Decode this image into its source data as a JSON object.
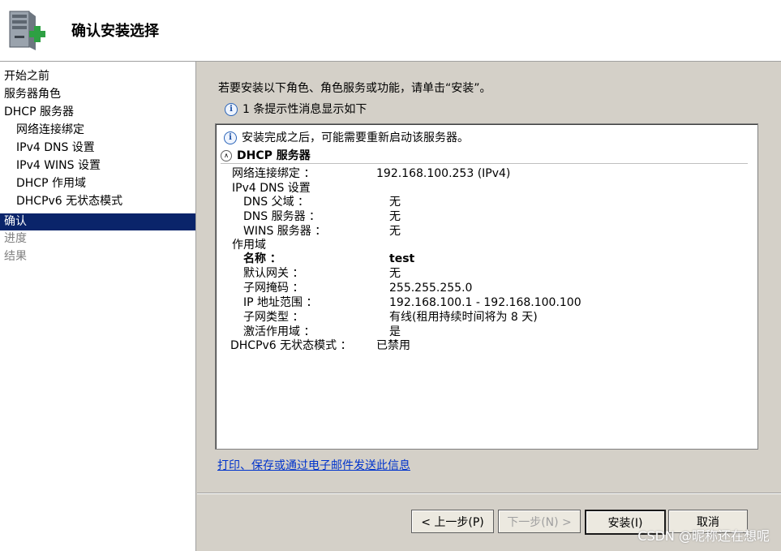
{
  "header": {
    "title": "确认安装选择",
    "icon": "server-add-icon"
  },
  "nav": [
    {
      "label": "开始之前",
      "state": "normal",
      "level": 0
    },
    {
      "label": "服务器角色",
      "state": "normal",
      "level": 0
    },
    {
      "label": "DHCP 服务器",
      "state": "normal",
      "level": 0
    },
    {
      "label": "网络连接绑定",
      "state": "normal",
      "level": 1
    },
    {
      "label": "IPv4 DNS 设置",
      "state": "normal",
      "level": 1
    },
    {
      "label": "IPv4 WINS 设置",
      "state": "normal",
      "level": 1
    },
    {
      "label": "DHCP 作用域",
      "state": "normal",
      "level": 1
    },
    {
      "label": "DHCPv6 无状态模式",
      "state": "normal",
      "level": 1
    },
    {
      "label": "确认",
      "state": "active",
      "level": 0
    },
    {
      "label": "进度",
      "state": "disabled",
      "level": 0
    },
    {
      "label": "结果",
      "state": "disabled",
      "level": 0
    }
  ],
  "main": {
    "intro": "若要安装以下角色、角色服务或功能，请单击“安装”。",
    "info_count": "1 条提示性消息显示如下",
    "panel": {
      "note": "安装完成之后，可能需要重新启动该服务器。",
      "section_title": "DHCP 服务器",
      "rows": [
        {
          "label": "网络连接绑定 ：",
          "value": "192.168.100.253 (IPv4)"
        },
        {
          "label": "IPv4 DNS 设置",
          "value": ""
        },
        {
          "label": "DNS 父域 ：",
          "value": "无"
        },
        {
          "label": "DNS 服务器 ：",
          "value": "无"
        },
        {
          "label": "WINS 服务器 ：",
          "value": "无"
        },
        {
          "label": "作用域",
          "value": ""
        },
        {
          "label": "名称 ：",
          "value": "test"
        },
        {
          "label": "默认网关 ：",
          "value": "无"
        },
        {
          "label": "子网掩码 ：",
          "value": "255.255.255.0"
        },
        {
          "label": "IP 地址范围 ：",
          "value": "192.168.100.1 - 192.168.100.100"
        },
        {
          "label": "子网类型 ：",
          "value": "有线(租用持续时间将为 8 天)"
        },
        {
          "label": "激活作用域 ：",
          "value": "是"
        },
        {
          "label": "DHCPv6 无状态模式 ：",
          "value": "已禁用"
        }
      ]
    },
    "link": "打印、保存或通过电子邮件发送此信息"
  },
  "buttons": {
    "prev": "< 上一步(P)",
    "next": "下一步(N) >",
    "install": "安装(I)",
    "cancel": "取消"
  },
  "watermark": "CSDN @昵称还在想呢"
}
